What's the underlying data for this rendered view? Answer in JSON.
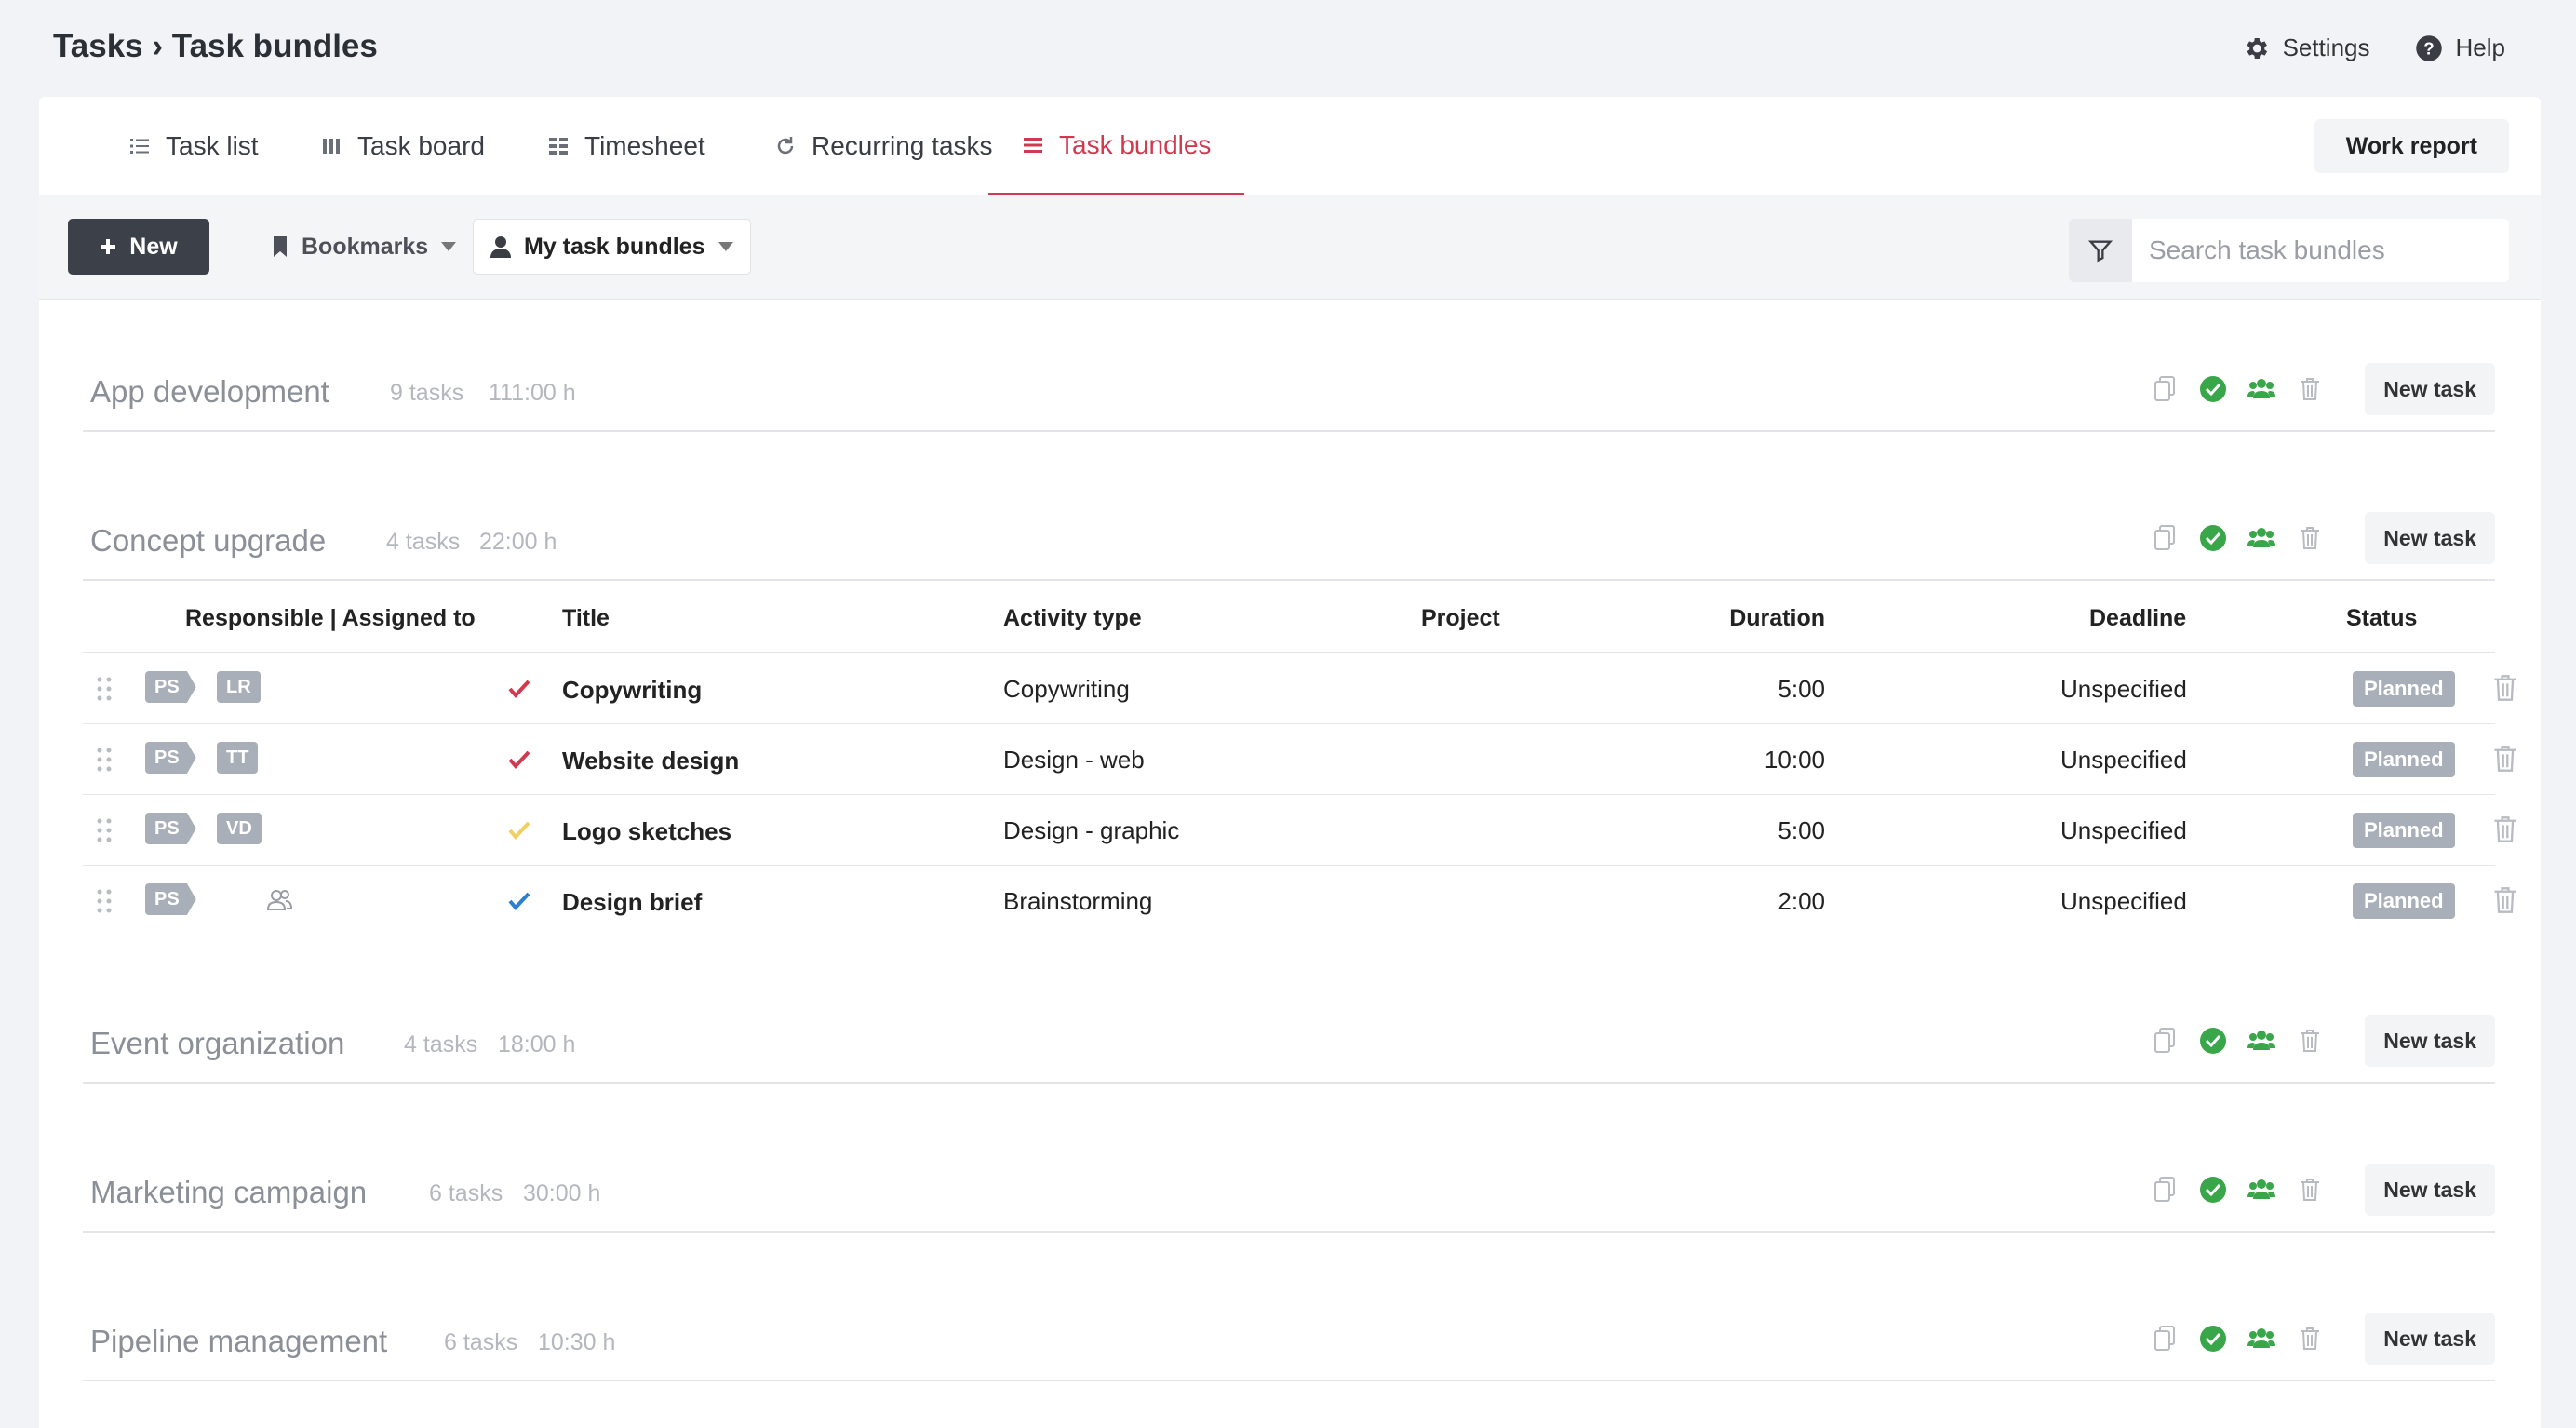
{
  "header": {
    "crumb_root": "Tasks",
    "crumb_sep": "›",
    "crumb_current": "Task bundles",
    "settings_label": "Settings",
    "help_label": "Help"
  },
  "tabs": [
    {
      "label": "Task list",
      "icon": "list-icon"
    },
    {
      "label": "Task board",
      "icon": "board-icon"
    },
    {
      "label": "Timesheet",
      "icon": "grid-icon"
    },
    {
      "label": "Recurring tasks",
      "icon": "refresh-icon"
    },
    {
      "label": "Task bundles",
      "icon": "bundles-icon",
      "active": true
    }
  ],
  "work_report_label": "Work report",
  "toolbar": {
    "new_label": "New",
    "bookmarks_label": "Bookmarks",
    "my_bundles_label": "My task bundles",
    "search_placeholder": "Search task bundles"
  },
  "new_task_label": "New task",
  "bundles": [
    {
      "name": "App development",
      "tasks": "9 tasks",
      "hours": "111:00 h"
    },
    {
      "name": "Concept upgrade",
      "tasks": "4 tasks",
      "hours": "22:00 h"
    },
    {
      "name": "Event organization",
      "tasks": "4 tasks",
      "hours": "18:00 h"
    },
    {
      "name": "Marketing campaign",
      "tasks": "6 tasks",
      "hours": "30:00 h"
    },
    {
      "name": "Pipeline management",
      "tasks": "6 tasks",
      "hours": "10:30 h"
    }
  ],
  "table": {
    "headers": {
      "responsible": "Responsible | Assigned to",
      "title": "Title",
      "activity": "Activity type",
      "project": "Project",
      "duration": "Duration",
      "deadline": "Deadline",
      "status": "Status"
    },
    "rows": [
      {
        "responsible": "PS",
        "assigned": "LR",
        "check_color": "#d1394f",
        "title": "Copywriting",
        "activity": "Copywriting",
        "duration": "5:00",
        "deadline": "Unspecified",
        "status": "Planned"
      },
      {
        "responsible": "PS",
        "assigned": "TT",
        "check_color": "#d1394f",
        "title": "Website design",
        "activity": "Design - web",
        "duration": "10:00",
        "deadline": "Unspecified",
        "status": "Planned"
      },
      {
        "responsible": "PS",
        "assigned": "VD",
        "check_color": "#f0d060",
        "title": "Logo sketches",
        "activity": "Design - graphic",
        "duration": "5:00",
        "deadline": "Unspecified",
        "status": "Planned"
      },
      {
        "responsible": "PS",
        "assigned": "",
        "check_color": "#2d7fd3",
        "title": "Design brief",
        "activity": "Brainstorming",
        "duration": "2:00",
        "deadline": "Unspecified",
        "status": "Planned"
      }
    ]
  },
  "colors": {
    "accent": "#d1394f",
    "success": "#3aa64a",
    "badge": "#a9afb8"
  }
}
